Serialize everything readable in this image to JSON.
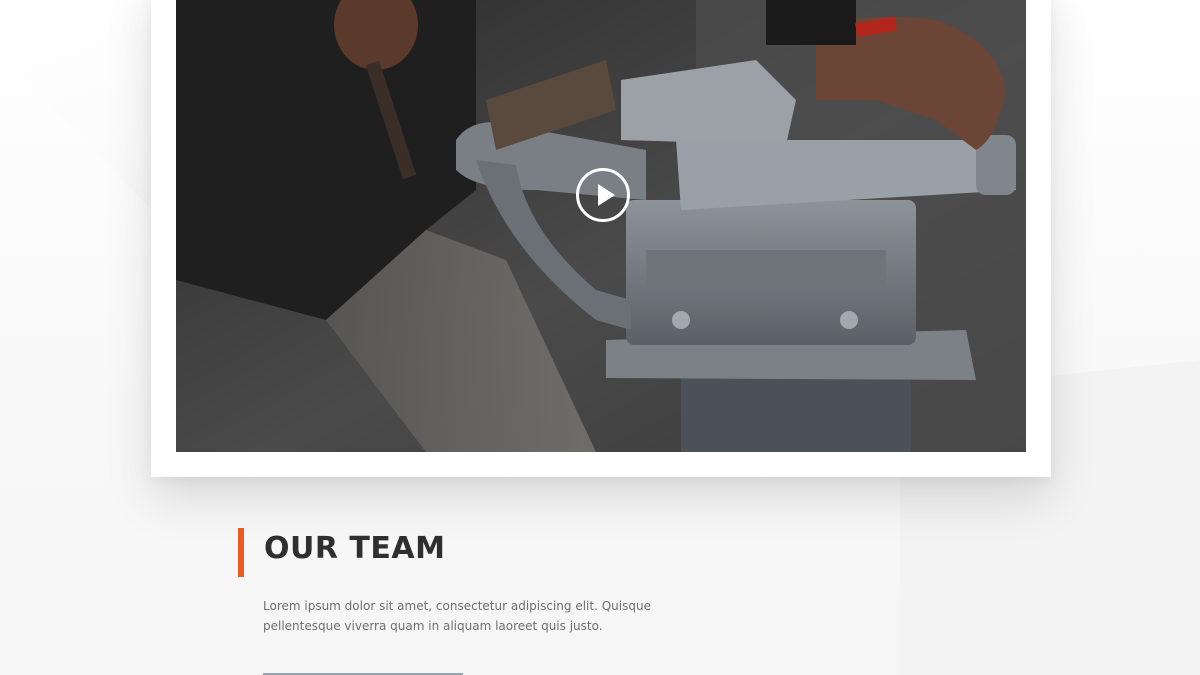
{
  "video": {
    "play_icon": "play-icon",
    "colors": {
      "frame": "#ffffff",
      "play": "#ffffff"
    }
  },
  "team": {
    "title": "OUR TEAM",
    "description": "Lorem ipsum dolor sit amet, consectetur adipiscing elit. Quisque pellentesque viverra quam in aliquam laoreet quis justo.",
    "accent_color": "#ee5a24"
  }
}
